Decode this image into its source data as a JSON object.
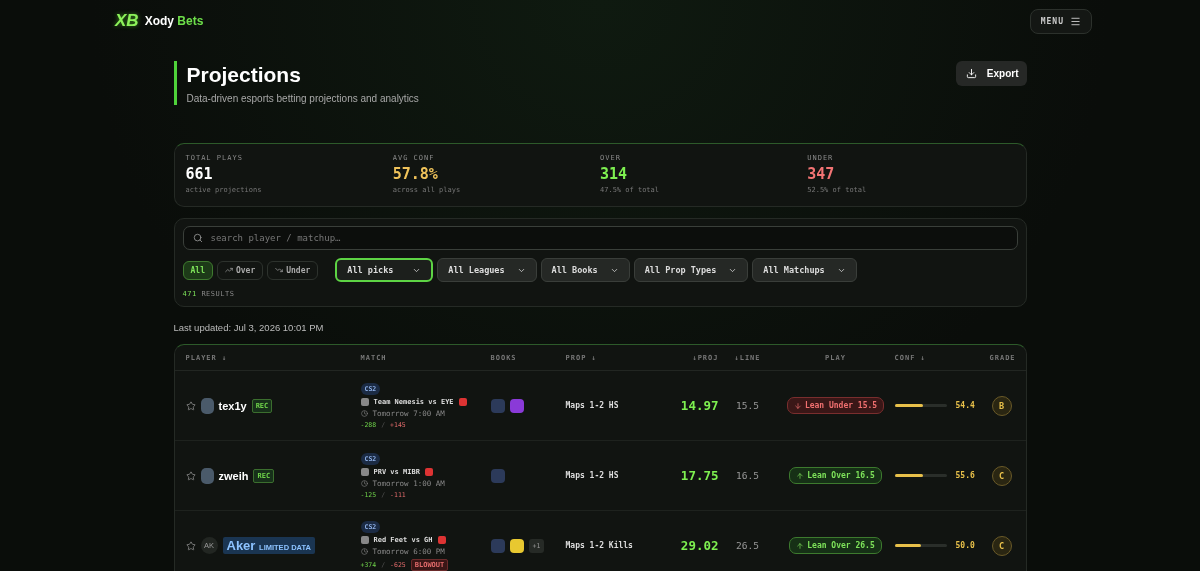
{
  "brand": {
    "logo": "XB",
    "name": "Xody",
    "accent": "Bets"
  },
  "menu_button": "MENU",
  "page": {
    "title": "Projections",
    "subtitle": "Data-driven esports betting projections and analytics",
    "export_button": "Export"
  },
  "stats": [
    {
      "label": "TOTAL PLAYS",
      "value": "661",
      "note": "active projections",
      "kind": "neutral"
    },
    {
      "label": "AVG CONF",
      "value": "57.8%",
      "note": "across all plays",
      "kind": "conf"
    },
    {
      "label": "OVER",
      "value": "314",
      "note": "47.5% of total",
      "kind": "over"
    },
    {
      "label": "UNDER",
      "value": "347",
      "note": "52.5% of total",
      "kind": "under"
    }
  ],
  "search": {
    "placeholder": "search player / matchup…"
  },
  "direction_filters": [
    {
      "label": "All",
      "selected": true,
      "kind": "all"
    },
    {
      "label": "Over",
      "selected": false,
      "kind": "over"
    },
    {
      "label": "Under",
      "selected": false,
      "kind": "under"
    }
  ],
  "dropdowns": [
    {
      "label": "All picks",
      "selected": true
    },
    {
      "label": "All Leagues",
      "selected": false
    },
    {
      "label": "All Books",
      "selected": false
    },
    {
      "label": "All Prop Types",
      "selected": false
    },
    {
      "label": "All Matchups",
      "selected": false
    }
  ],
  "results": {
    "count": "471",
    "label": "RESULTS"
  },
  "last_updated": "Last updated: Jul 3, 2026 10:01 PM",
  "table": {
    "columns": [
      "PLAYER ↓",
      "MATCH",
      "BOOKS",
      "PROP ↓",
      "↓PROJ",
      "↓LINE",
      "PLAY",
      "CONF ↓",
      "GRADE"
    ],
    "rows": [
      {
        "player": "tex1y",
        "badge": {
          "label": "REC",
          "kind": "rec"
        },
        "game": "CS2",
        "match": "Team Nemesis vs EYE",
        "time": "Tomorrow 7:00 AM",
        "odds": [
          "-288",
          "/",
          "+145"
        ],
        "books": [
          {
            "color": "#2c3a5a"
          },
          {
            "color": "#8a3ad8"
          }
        ],
        "prop": "Maps 1-2 HS",
        "proj": "14.97",
        "line": "15.5",
        "play": {
          "label": "Lean Under 15.5",
          "over": false
        },
        "conf": {
          "level": 0.544,
          "reading": "54.4"
        },
        "grade": "B"
      },
      {
        "player": "zweih",
        "badge": {
          "label": "REC",
          "kind": "rec"
        },
        "game": "CS2",
        "match": "PRV vs MIBR",
        "time": "Tomorrow 1:00 AM",
        "odds": [
          "-125",
          "/",
          "-111"
        ],
        "books": [
          {
            "color": "#2c3a5a"
          }
        ],
        "prop": "Maps 1-2 HS",
        "proj": "17.75",
        "line": "16.5",
        "play": {
          "label": "Lean Over 16.5",
          "over": true
        },
        "conf": {
          "level": 0.556,
          "reading": "55.6"
        },
        "grade": "C"
      },
      {
        "player": "Aker",
        "initials": "AK",
        "badge": {
          "label": "LIMITED DATA",
          "kind": "limited"
        },
        "game": "CS2",
        "match": "Red Feet vs GH",
        "time": "Tomorrow 6:00 PM",
        "odds": [
          "+374",
          "/",
          "-625"
        ],
        "tag": "BLOWOUT",
        "books": [
          {
            "color": "#2c3a5a"
          },
          {
            "color": "#e8c830"
          }
        ],
        "more_books": "+1",
        "prop": "Maps 1-2 Kills",
        "proj": "29.02",
        "line": "26.5",
        "play": {
          "label": "Lean Over 26.5",
          "over": true
        },
        "conf": {
          "level": 0.5,
          "reading": "50.0"
        },
        "grade": "C"
      }
    ]
  }
}
